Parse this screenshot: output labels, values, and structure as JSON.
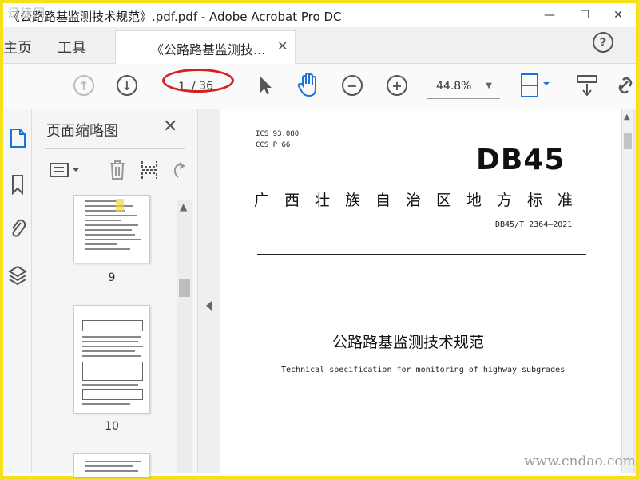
{
  "window": {
    "title": "《公路路基监测技术规范》.pdf.pdf - Adobe Acrobat Pro DC",
    "watermark_top": "迅捷网",
    "min_label": "—",
    "max_label": "☐",
    "close_label": "✕"
  },
  "nav": {
    "home_label": "主页",
    "tools_label": "工具",
    "doc_tab_label": "《公路路基监测技...",
    "help_label": "?"
  },
  "toolbar": {
    "page_current": "1",
    "page_total": "/ 36",
    "zoom_value": "44.8%",
    "annotation_color": "#d42020"
  },
  "thumbnail_panel": {
    "title": "页面缩略图",
    "pages": [
      {
        "number": "9"
      },
      {
        "number": "10"
      }
    ]
  },
  "document": {
    "ics": "ICS  93.080",
    "ccs": "CCS  P  66",
    "logo_text": "DB45",
    "standard_type": "广西壮族自治区地方标准",
    "standard_code": "DB45/T 2364—2021",
    "title_cn": "公路路基监测技术规范",
    "title_en": "Technical specification for monitoring of highway subgrades"
  },
  "site_watermark": "www.cndao.com"
}
